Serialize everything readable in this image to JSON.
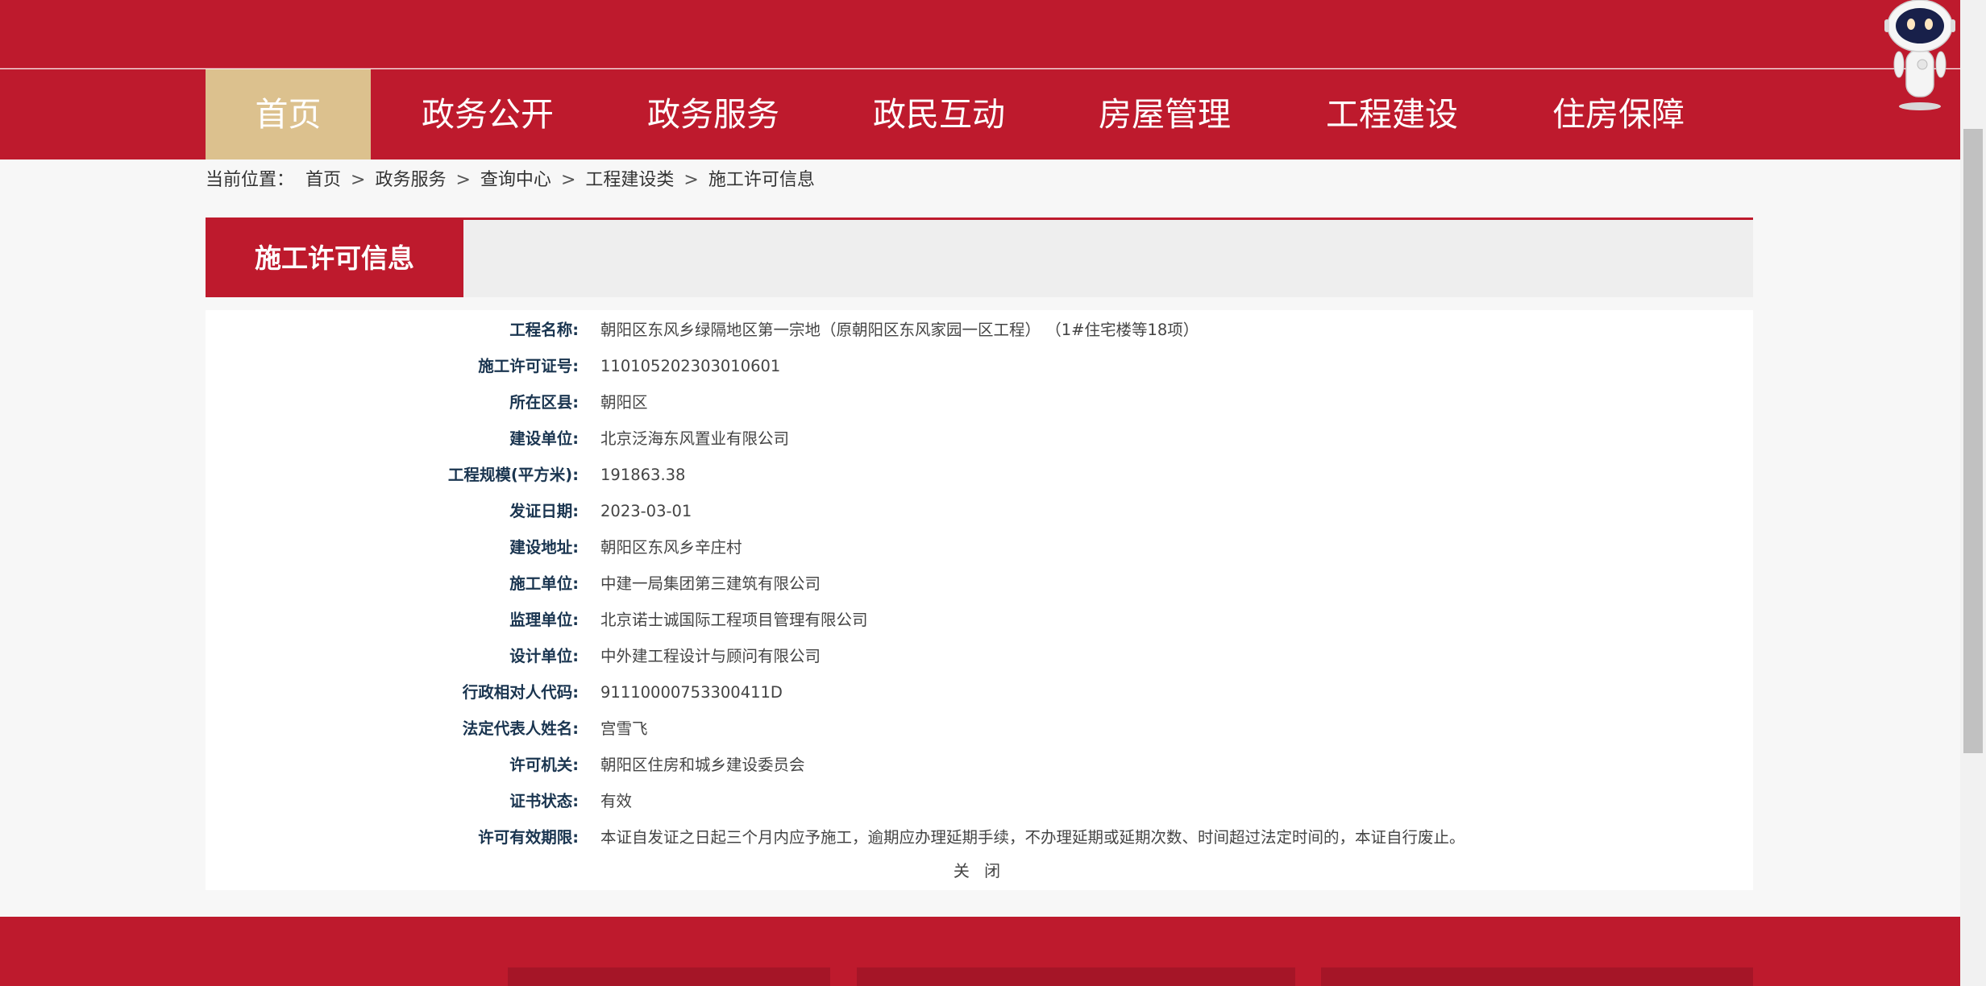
{
  "nav": {
    "items": [
      {
        "label": "首页"
      },
      {
        "label": "政务公开"
      },
      {
        "label": "政务服务"
      },
      {
        "label": "政民互动"
      },
      {
        "label": "房屋管理"
      },
      {
        "label": "工程建设"
      },
      {
        "label": "住房保障"
      }
    ]
  },
  "breadcrumb": {
    "prefix": "当前位置：",
    "items": [
      "首页",
      "政务服务",
      "查询中心",
      "工程建设类",
      "施工许可信息"
    ],
    "separator": ">"
  },
  "panel": {
    "title": "施工许可信息"
  },
  "details": [
    {
      "label": "工程名称:",
      "value": "朝阳区东风乡绿隔地区第一宗地（原朝阳区东风家园一区工程） （1#住宅楼等18项）"
    },
    {
      "label": "施工许可证号:",
      "value": "110105202303010601"
    },
    {
      "label": "所在区县:",
      "value": "朝阳区"
    },
    {
      "label": "建设单位:",
      "value": "北京泛海东风置业有限公司"
    },
    {
      "label": "工程规模(平方米):",
      "value": "191863.38"
    },
    {
      "label": "发证日期:",
      "value": "2023-03-01"
    },
    {
      "label": "建设地址:",
      "value": "朝阳区东风乡辛庄村"
    },
    {
      "label": "施工单位:",
      "value": "中建一局集团第三建筑有限公司"
    },
    {
      "label": "监理单位:",
      "value": "北京诺士诚国际工程项目管理有限公司"
    },
    {
      "label": "设计单位:",
      "value": "中外建工程设计与顾问有限公司"
    },
    {
      "label": "行政相对人代码:",
      "value": "91110000753300411D"
    },
    {
      "label": "法定代表人姓名:",
      "value": "宫雪飞"
    },
    {
      "label": "许可机关:",
      "value": "朝阳区住房和城乡建设委员会"
    },
    {
      "label": "证书状态:",
      "value": "有效"
    },
    {
      "label": "许可有效期限:",
      "value": "本证自发证之日起三个月内应予施工，逾期应办理延期手续，不办理延期或延期次数、时间超过法定时间的，本证自行废止。"
    }
  ],
  "close_label": "关 闭",
  "colors": {
    "brand_red": "#be1a2d",
    "nav_active": "#dcc18e",
    "label_text": "#1a3550"
  },
  "icons": {
    "assistant": "robot-assistant-icon"
  }
}
